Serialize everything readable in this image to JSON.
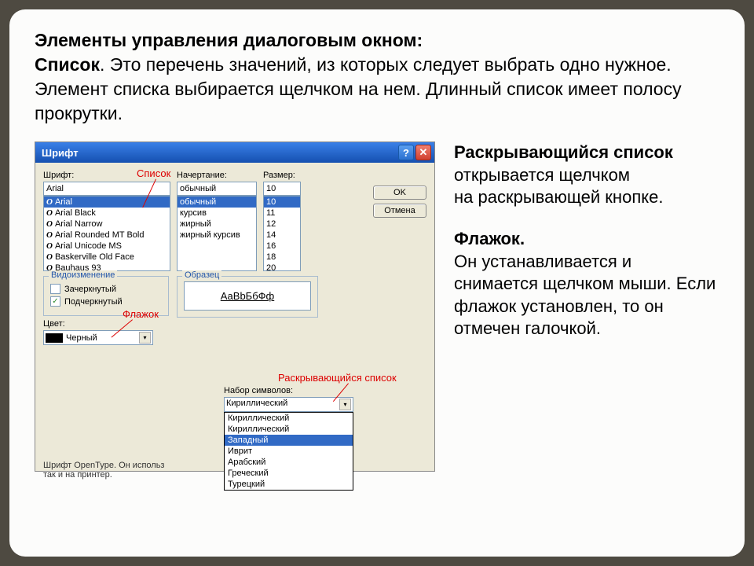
{
  "header": {
    "title": "Элементы управления диалоговым окном:",
    "list_label": "Список",
    "list_desc": ". Это перечень значений, из которых следует выбрать одно нужное. Элемент списка выбирается щелчком на нем. Длинный список имеет полосу прокрутки."
  },
  "side_text": {
    "dropdown_b": "Раскрывающийся список",
    "dropdown_rest": " открывается щелчком",
    "dropdown_line2": " на раскрывающей кнопке.",
    "checkbox_b": "Флажок.",
    "checkbox_rest": "Он устанавливается и снимается щелчком мыши. Если флажок установлен, то он отмечен галочкой."
  },
  "callouts": {
    "list": "Список",
    "checkbox": "Флажок",
    "dropdown": "Раскрывающийся список"
  },
  "dialog": {
    "title": "Шрифт",
    "font_label": "Шрифт:",
    "font_value": "Arial",
    "font_items": [
      "Arial",
      "Arial Black",
      "Arial Narrow",
      "Arial Rounded MT Bold",
      "Arial Unicode MS",
      "Baskerville Old Face",
      "Bauhaus 93"
    ],
    "style_label": "Начертание:",
    "style_value": "обычный",
    "style_items": [
      "обычный",
      "курсив",
      "жирный",
      "жирный курсив"
    ],
    "size_label": "Размер:",
    "size_value": "10",
    "size_items": [
      "10",
      "11",
      "12",
      "14",
      "16",
      "18",
      "20"
    ],
    "ok": "OK",
    "cancel": "Отмена",
    "mod_legend": "Видоизменение",
    "strike": "Зачеркнутый",
    "underline": "Подчеркнутый",
    "sample_legend": "Образец",
    "sample_text": "АаBbБбФф",
    "color_label": "Цвет:",
    "color_value": "Черный",
    "charset_label": "Набор символов:",
    "charset_value": "Кириллический",
    "charset_items": [
      "Кириллический",
      "Кириллический",
      "Западный",
      "Иврит",
      "Арабский",
      "Греческий",
      "Турецкий"
    ],
    "footer_text": "Шрифт OpenType. Он используется так и на принтер."
  }
}
